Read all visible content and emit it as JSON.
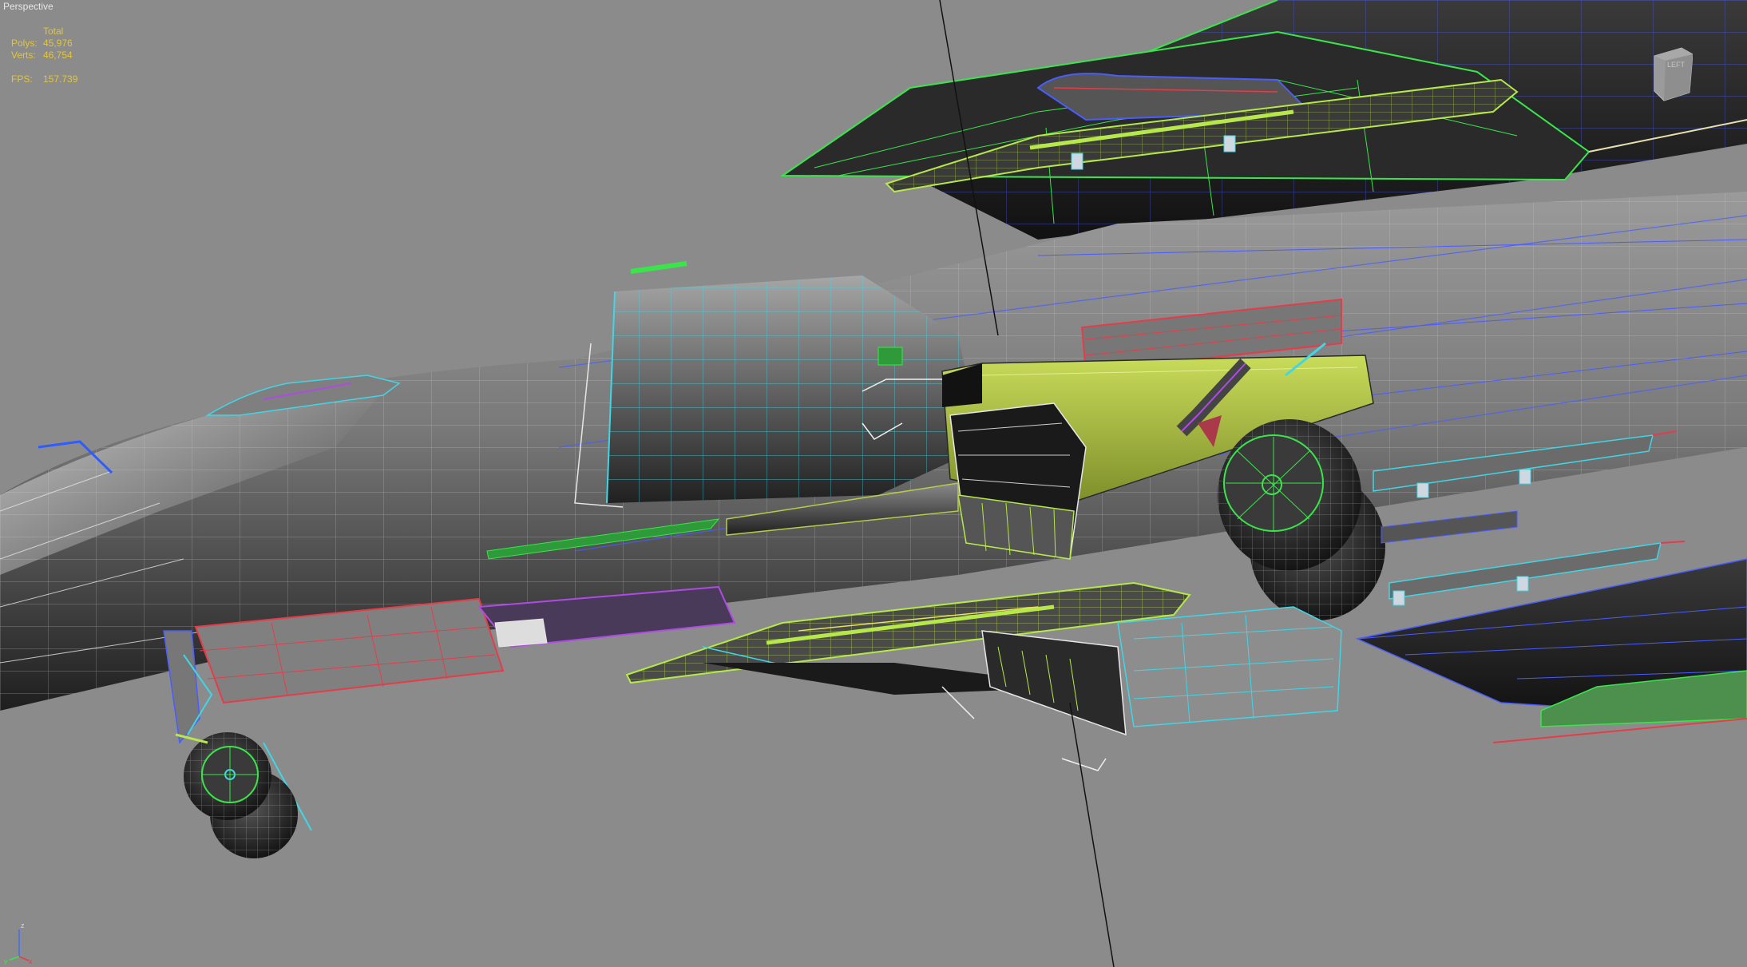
{
  "viewport": {
    "label": "Perspective"
  },
  "statistics": {
    "header": "Total",
    "polys_label": "Polys:",
    "polys_value": "45,976",
    "verts_label": "Verts:",
    "verts_value": "46,754",
    "fps_label": "FPS:",
    "fps_value": "157.739"
  },
  "viewcube": {
    "face_label": "LEFT"
  },
  "axis": {
    "z": "z",
    "x": "x",
    "y": "y"
  },
  "colors": {
    "background": "#8b8b8b",
    "stats_text": "#e2c63a",
    "wire_green": "#39e64a",
    "wire_cyan": "#3fd6e6",
    "wire_blue": "#4a5cff",
    "wire_red": "#e63c4a",
    "wire_purple": "#b04ae6",
    "yellow_part": "#b6cc48"
  }
}
